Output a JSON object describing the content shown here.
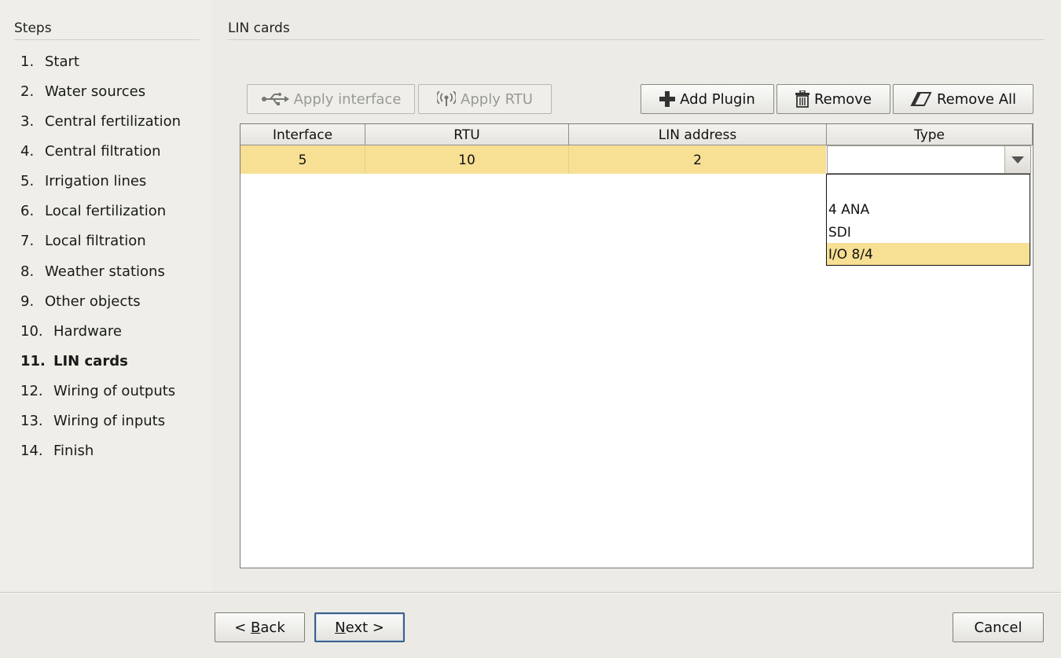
{
  "sidebar": {
    "title": "Steps",
    "items": [
      {
        "num": "1.",
        "label": "Start"
      },
      {
        "num": "2.",
        "label": "Water sources"
      },
      {
        "num": "3.",
        "label": "Central fertilization"
      },
      {
        "num": "4.",
        "label": "Central filtration"
      },
      {
        "num": "5.",
        "label": "Irrigation lines"
      },
      {
        "num": "6.",
        "label": "Local fertilization"
      },
      {
        "num": "7.",
        "label": "Local filtration"
      },
      {
        "num": "8.",
        "label": "Weather stations"
      },
      {
        "num": "9.",
        "label": "Other objects"
      },
      {
        "num": "10.",
        "label": "Hardware"
      },
      {
        "num": "11.",
        "label": "LIN cards"
      },
      {
        "num": "12.",
        "label": "Wiring of outputs"
      },
      {
        "num": "13.",
        "label": "Wiring of inputs"
      },
      {
        "num": "14.",
        "label": "Finish"
      }
    ],
    "active_index": 10
  },
  "main": {
    "title": "LIN cards"
  },
  "toolbar": {
    "apply_interface": "Apply interface",
    "apply_rtu": "Apply RTU",
    "add_plugin": "Add Plugin",
    "remove": "Remove",
    "remove_all": "Remove All"
  },
  "table": {
    "columns": [
      "Interface",
      "RTU",
      "LIN address",
      "Type"
    ],
    "rows": [
      {
        "interface": "5",
        "rtu": "10",
        "lin_address": "2",
        "type": ""
      }
    ]
  },
  "type_dropdown": {
    "options": [
      "",
      "4 ANA",
      "SDI",
      "I/O 8/4"
    ],
    "highlighted": "I/O 8/4"
  },
  "footer": {
    "back_prefix": "< ",
    "back_mnemonic": "B",
    "back_rest": "ack",
    "next_mnemonic": "N",
    "next_rest": "ext >",
    "cancel": "Cancel"
  },
  "colors": {
    "selection": "#f7df94",
    "background": "#ebeae4",
    "default_button_border": "#3c5f8c"
  }
}
